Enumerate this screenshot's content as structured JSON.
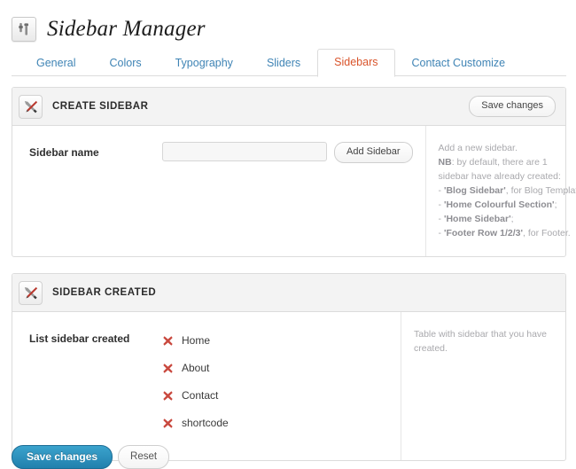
{
  "header": {
    "title": "Sidebar Manager",
    "icon": "sliders-icon"
  },
  "tabs": [
    {
      "label": "General",
      "active": false
    },
    {
      "label": "Colors",
      "active": false
    },
    {
      "label": "Typography",
      "active": false
    },
    {
      "label": "Sliders",
      "active": false
    },
    {
      "label": "Sidebars",
      "active": true
    },
    {
      "label": "Contact Customize",
      "active": false
    }
  ],
  "panels": {
    "create_sidebar": {
      "title": "CREATE SIDEBAR",
      "icon": "tools-icon",
      "save_label": "Save changes",
      "field_label": "Sidebar name",
      "input_value": "",
      "input_placeholder": "",
      "add_button_label": "Add Sidebar",
      "description": {
        "intro": "Add a new sidebar.",
        "nb_prefix": "NB",
        "nb_text": ": by default, there are 1 sidebar have already created:",
        "items": [
          {
            "dash": "- ",
            "name": "'Blog Sidebar'",
            "rest": ", for Blog Template;"
          },
          {
            "dash": "- ",
            "name": "'Home Colourful Section'",
            "rest": ";"
          },
          {
            "dash": "- ",
            "name": "'Home Sidebar'",
            "rest": ";"
          },
          {
            "dash": "- ",
            "name": "'Footer Row 1/2/3'",
            "rest": ", for Footer."
          }
        ]
      }
    },
    "sidebar_created": {
      "title": "SIDEBAR CREATED",
      "icon": "tools-icon",
      "field_label": "List sidebar created",
      "items": [
        {
          "label": "Home",
          "icon": "delete-x-icon"
        },
        {
          "label": "About",
          "icon": "delete-x-icon"
        },
        {
          "label": "Contact",
          "icon": "delete-x-icon"
        },
        {
          "label": "shortcode",
          "icon": "delete-x-icon"
        }
      ],
      "description": "Table with sidebar that you have created."
    }
  },
  "footer": {
    "save_label": "Save changes",
    "reset_label": "Reset"
  },
  "colors": {
    "tab_link": "#3f84b5",
    "tab_active": "#d9542b",
    "primary_button": "#2180ad",
    "delete_icon": "#c9493f",
    "panel_border": "#dcdcdc",
    "panel_head_bg": "#f3f3f3",
    "description_text": "#a9a9ad"
  }
}
